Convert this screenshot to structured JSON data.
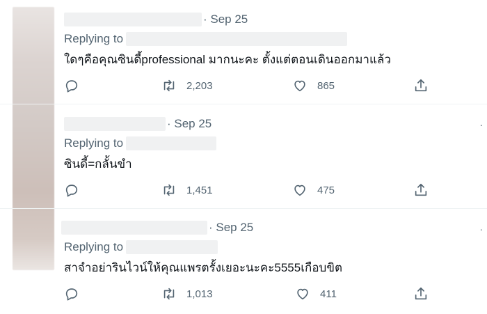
{
  "tweets": [
    {
      "date": "· Sep 25",
      "replying_label": "Replying to",
      "text": "ใดๆคือคุณซินดี้professional มากนะคะ ตั้งแต่ตอนเดินออกมาแล้ว",
      "retweets": "2,203",
      "likes": "865"
    },
    {
      "date": "· Sep 25",
      "replying_label": "Replying to",
      "text": "ซินดี้=กลั้นขำ",
      "retweets": "1,451",
      "likes": "475"
    },
    {
      "date": "· Sep 25",
      "replying_label": "Replying to",
      "text": "สาจำอย่ารินไวน์ให้คุณแพรตรั้งเยอะนะคะ5555เกือบขิต",
      "retweets": "1,013",
      "likes": "411"
    }
  ],
  "more_glyph": "·",
  "icons": [
    "reply-icon",
    "retweet-icon",
    "like-icon",
    "share-icon"
  ],
  "colors": {
    "text": "#0f1419",
    "secondary": "#536471",
    "divider": "#eff3f4"
  }
}
